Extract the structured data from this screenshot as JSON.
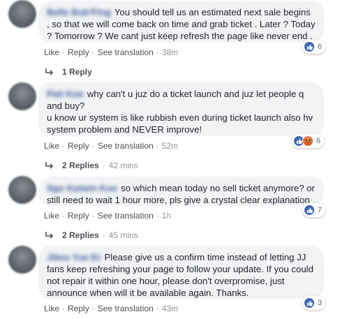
{
  "comments": [
    {
      "name": "Belle Bob'Fing",
      "text": "You should tell us an estimated next sale begins , so that we will come back on time and grab ticket . Later ? Today ? Tomorrow ? We cant just keep refresh the page like never end .",
      "time": "38m",
      "reaction_count": "6",
      "replies_label": "1 Reply",
      "replies_time": ""
    },
    {
      "name": "Pati Koe",
      "text": "why can't u juz do a ticket launch and juz let people q and buy?\nu know ur system is like rubbish even during ticket launch also hv system problem and NEVER improve!",
      "time": "52m",
      "reaction_count": "6",
      "replies_label": "2 Replies",
      "replies_time": "42 mins"
    },
    {
      "name": "Sgo Ketwin Koo",
      "text": "so which mean today no sell ticket anymore? or still need to wait 1 hour more, pls give a crystal clear explanation",
      "time": "1h",
      "reaction_count": "7",
      "replies_label": "2 Replies",
      "replies_time": "45 mins"
    },
    {
      "name": "Jikes Yue Er",
      "text": "Please give us a confirm time instead of letting JJ fans keep refreshing your page to follow your update. If you could not repair it within one hour, please don't overpromise, just announce when will it be available again. Thanks.",
      "time": "43m",
      "reaction_count": "3"
    }
  ],
  "actions": {
    "like": "Like",
    "reply": "Reply",
    "see_translation": "See translation",
    "separator": "·"
  },
  "colors": {
    "bubble": "#f2f3f5",
    "link": "#4267b2",
    "name": "#385898",
    "like_icon": "#4267b2",
    "angry_icon": "#e0551f"
  },
  "icons": [
    "like-icon",
    "angry-icon",
    "reply-arrow-icon"
  ]
}
